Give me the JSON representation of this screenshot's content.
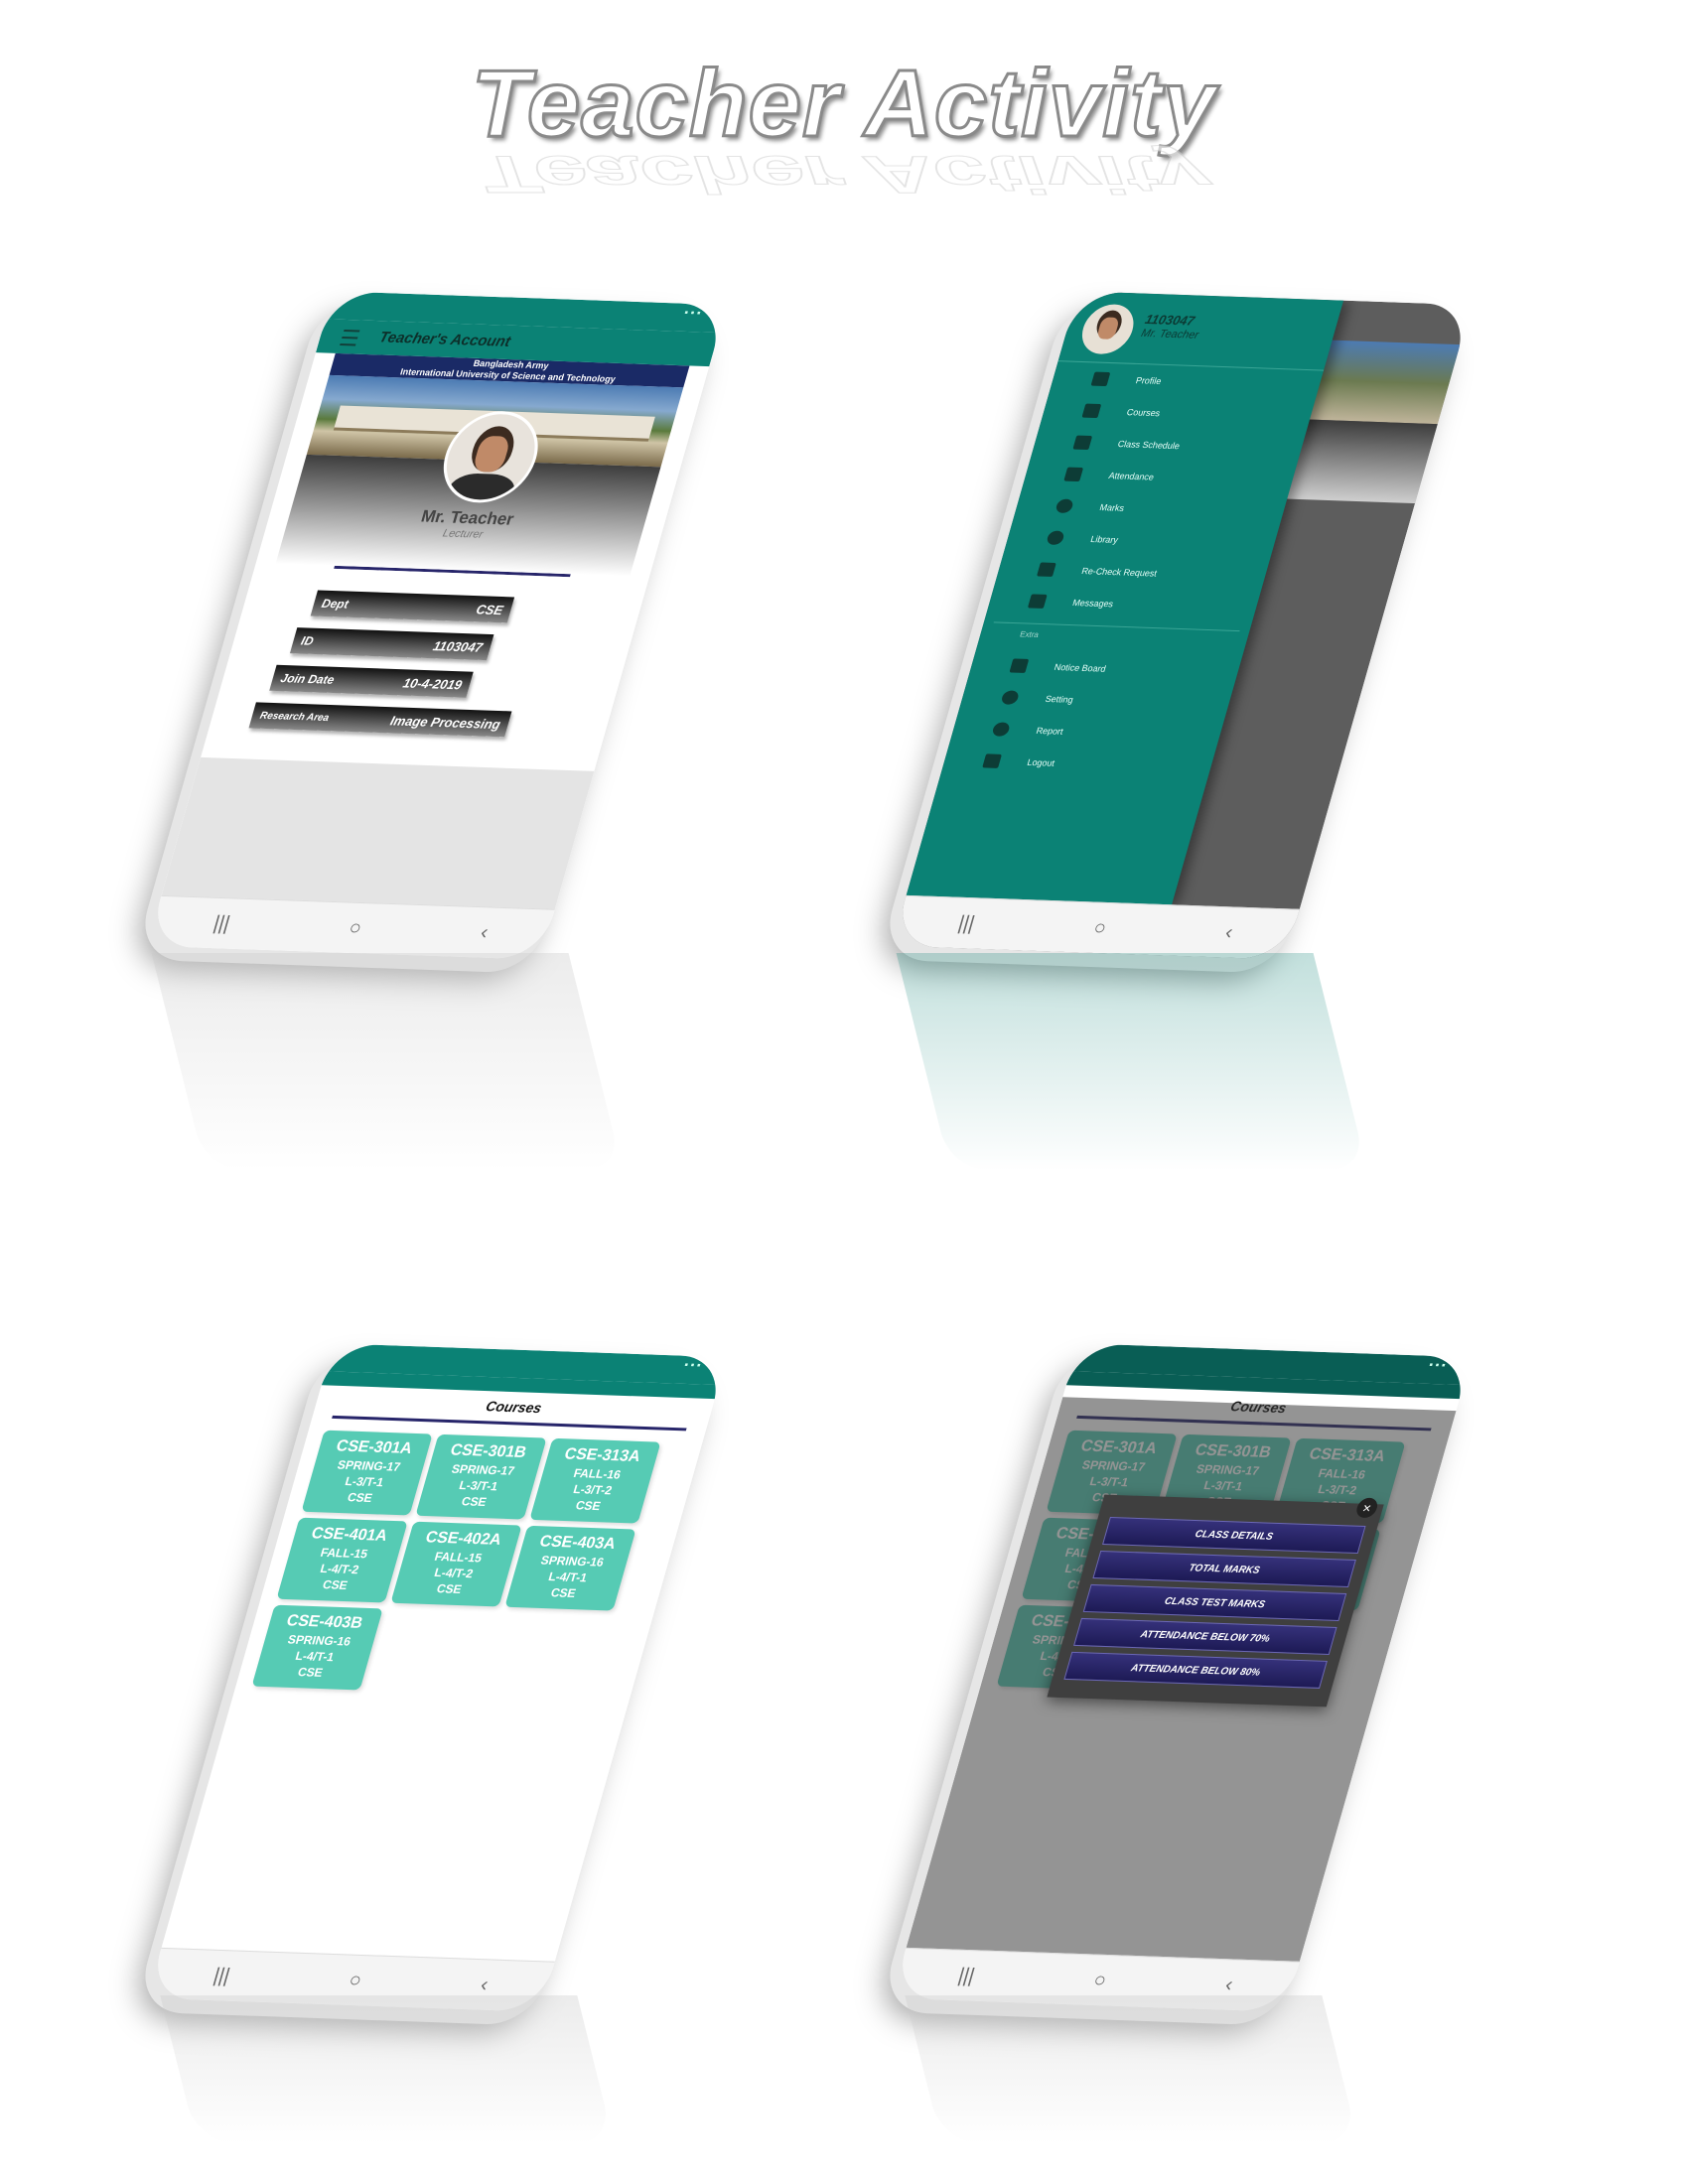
{
  "header": {
    "title": "Teacher Activity"
  },
  "colors": {
    "teal": "#0b8275",
    "card": "#56cbb4",
    "navy": "#27256a"
  },
  "profile_screen": {
    "appbar_title": "Teacher's Account",
    "banner_line1": "Bangladesh Army",
    "banner_line2": "International University of Science and Technology",
    "name": "Mr. Teacher",
    "role": "Lecturer",
    "fields": [
      {
        "label": "Dept",
        "value": "CSE"
      },
      {
        "label": "ID",
        "value": "1103047"
      },
      {
        "label": "Join Date",
        "value": "10-4-2019"
      },
      {
        "label": "Research Area",
        "value": "Image Processing"
      }
    ]
  },
  "drawer_screen": {
    "user_id": "1103047",
    "user_name": "Mr. Teacher",
    "items": [
      "Profile",
      "Courses",
      "Class Schedule",
      "Attendance",
      "Marks",
      "Library",
      "Re-Check Request",
      "Messages"
    ],
    "section_label": "Extra",
    "extra_items": [
      "Notice Board",
      "Setting",
      "Report",
      "Logout"
    ]
  },
  "courses_screen": {
    "title": "Courses",
    "courses": [
      {
        "code": "CSE-301A",
        "term": "SPRING-17",
        "level": "L-3/T-1",
        "dept": "CSE"
      },
      {
        "code": "CSE-301B",
        "term": "SPRING-17",
        "level": "L-3/T-1",
        "dept": "CSE"
      },
      {
        "code": "CSE-313A",
        "term": "FALL-16",
        "level": "L-3/T-2",
        "dept": "CSE"
      },
      {
        "code": "CSE-401A",
        "term": "FALL-15",
        "level": "L-4/T-2",
        "dept": "CSE"
      },
      {
        "code": "CSE-402A",
        "term": "FALL-15",
        "level": "L-4/T-2",
        "dept": "CSE"
      },
      {
        "code": "CSE-403A",
        "term": "SPRING-16",
        "level": "L-4/T-1",
        "dept": "CSE"
      },
      {
        "code": "CSE-403B",
        "term": "SPRING-16",
        "level": "L-4/T-1",
        "dept": "CSE"
      }
    ]
  },
  "dialog": {
    "buttons": [
      "CLASS DETAILS",
      "TOTAL MARKS",
      "CLASS TEST MARKS",
      "ATTENDANCE BELOW 70%",
      "ATTENDANCE BELOW 80%"
    ],
    "close_icon": "close-icon"
  },
  "nav_icons": [
    "recent-apps-icon",
    "home-icon",
    "back-icon"
  ]
}
